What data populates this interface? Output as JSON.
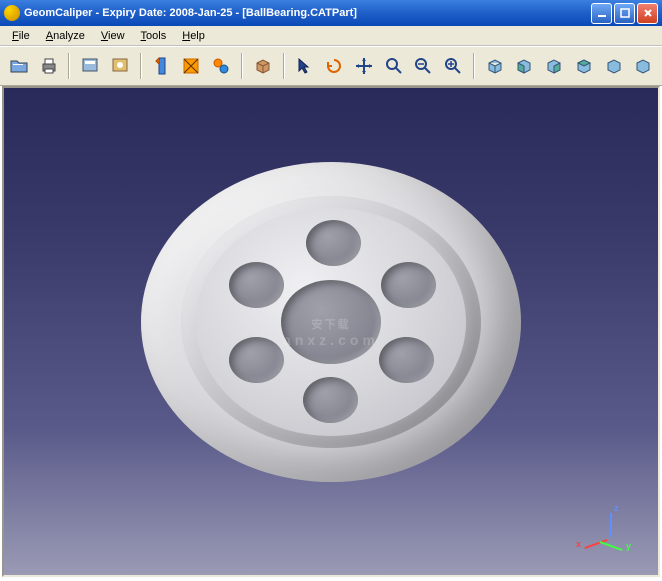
{
  "window": {
    "app_name": "GeomCaliper",
    "expiry_label": "Expiry Date:",
    "expiry_date": "2008-Jan-25",
    "document": "[BallBearing.CATPart]",
    "full_title": "GeomCaliper -   Expiry Date:  2008-Jan-25  - [BallBearing.CATPart]"
  },
  "menu": {
    "file": "File",
    "analyze": "Analyze",
    "view": "View",
    "tools": "Tools",
    "help": "Help"
  },
  "toolbar_icons": {
    "open": "open-file-icon",
    "print": "print-icon",
    "compute": "compute-icon",
    "settings": "settings-icon",
    "measure": "measure-icon",
    "measure_area": "measure-area-icon",
    "measure_group": "measure-group-icon",
    "package": "package-icon",
    "select": "select-arrow-icon",
    "rotate": "rotate-icon",
    "pan": "pan-icon",
    "zoom": "zoom-icon",
    "zoom_out": "zoom-out-icon",
    "zoom_in": "zoom-in-icon",
    "iso": "iso-view-icon",
    "front": "front-view-icon",
    "back": "back-view-icon",
    "left": "left-view-icon",
    "right": "right-view-icon",
    "top": "top-view-icon"
  },
  "viewport": {
    "model_name": "BallBearing",
    "axes": {
      "x": "x",
      "y": "y",
      "z": "z"
    }
  },
  "watermark": {
    "text": "安下载",
    "sub": "anxz.com"
  },
  "colors": {
    "titlebar_gradient_top": "#3b7fe0",
    "titlebar_gradient_bottom": "#0a4ab8",
    "menu_bg": "#ece9d8",
    "viewport_top": "#2a2a5a",
    "viewport_bottom": "#9a9ab5",
    "axis_x": "#ff4040",
    "axis_y": "#40ff40",
    "axis_z": "#6090ff"
  }
}
